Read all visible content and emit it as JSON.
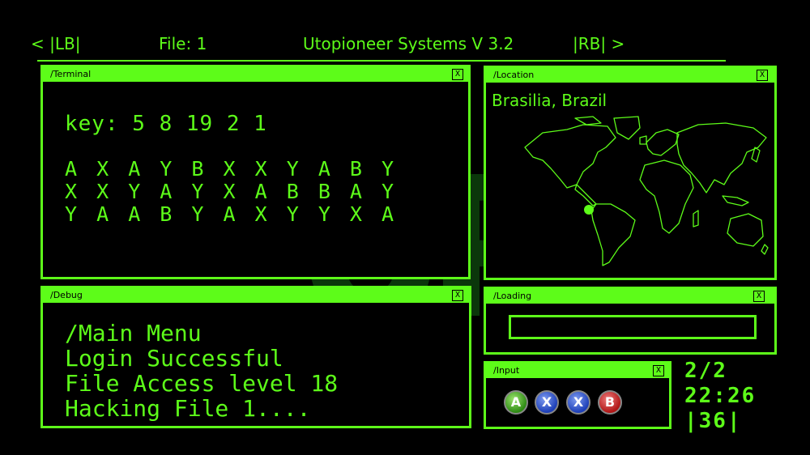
{
  "header": {
    "lb_nav": "< |LB|",
    "file_label": "File: 1",
    "system_title": "Utopioneer Systems V 3.2",
    "rb_nav": "|RB| >"
  },
  "terminal": {
    "title": "/Terminal",
    "close": "X",
    "key_line": "key: 5 8 19 2 1",
    "rows": [
      "A X A Y B X X Y A B Y",
      "X X Y A Y X A B B A Y",
      "Y A A B Y A X Y Y X A"
    ]
  },
  "location": {
    "title": "/Location",
    "close": "X",
    "place": "Brasilia, Brazil"
  },
  "debug": {
    "title": "/Debug",
    "close": "X",
    "lines": [
      "/Main Menu",
      "Login Successful",
      "File Access level 18",
      "Hacking File 1...."
    ]
  },
  "loading": {
    "title": "/Loading",
    "close": "X",
    "progress": 0
  },
  "input": {
    "title": "/Input",
    "close": "X",
    "buttons": [
      {
        "label": "A",
        "color": "#2e8a14"
      },
      {
        "label": "X",
        "color": "#1d3fb8"
      },
      {
        "label": "X",
        "color": "#1d3fb8"
      },
      {
        "label": "B",
        "color": "#b01515"
      }
    ]
  },
  "status": {
    "files": "2/2",
    "clock": "22:26",
    "counter": "|36|"
  },
  "colors": {
    "accent": "#5dfc19",
    "background": "#000000"
  }
}
